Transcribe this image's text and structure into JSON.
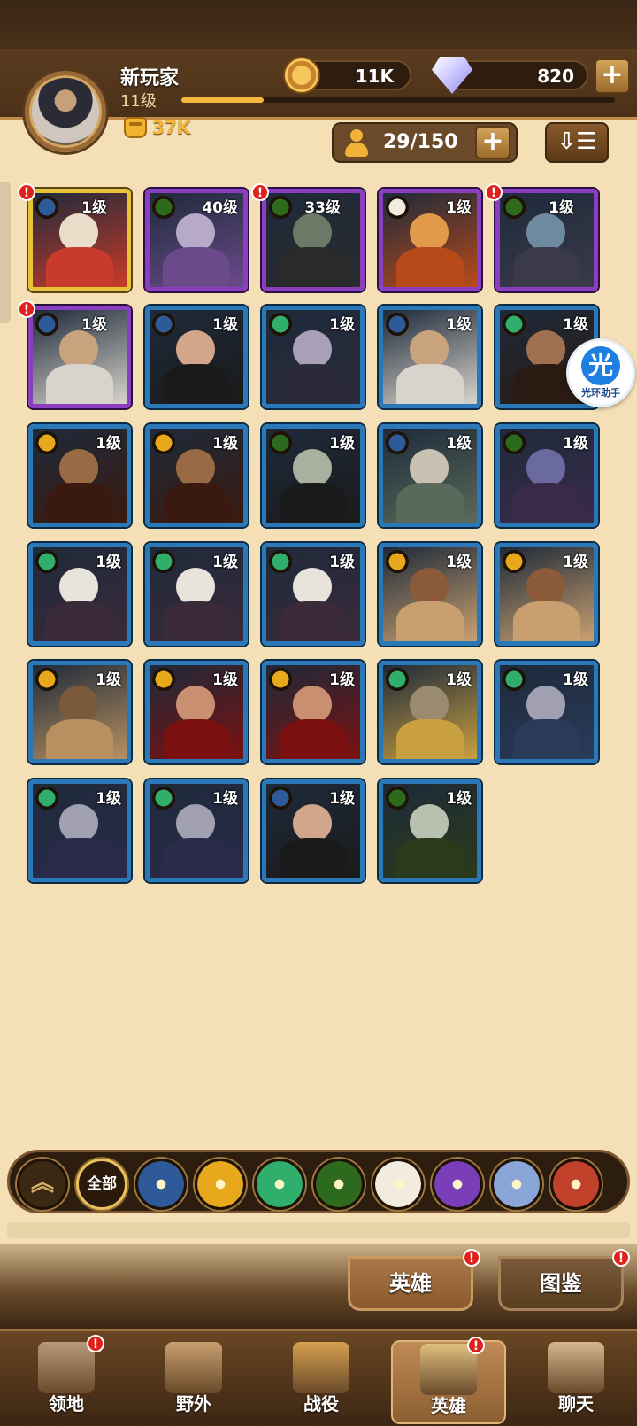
{
  "player": {
    "name": "新玩家",
    "level": "11级",
    "exp_fraction": 0.19,
    "power": "37K"
  },
  "resources": {
    "gold": "11K",
    "gems": "820"
  },
  "roster": {
    "count": "29/150"
  },
  "helper": {
    "glyph": "光",
    "label": "光环助手"
  },
  "heroes": [
    {
      "level": "1级",
      "rarity": "gold",
      "faction": "lightbearer",
      "alert": "!"
    },
    {
      "level": "40级",
      "rarity": "purple",
      "faction": "graveborn",
      "alert": ""
    },
    {
      "level": "33级",
      "rarity": "purple",
      "faction": "graveborn",
      "alert": "!"
    },
    {
      "level": "1级",
      "rarity": "purple",
      "faction": "celestial",
      "alert": ""
    },
    {
      "level": "1级",
      "rarity": "purple",
      "faction": "graveborn",
      "alert": "!"
    },
    {
      "level": "1级",
      "rarity": "purple",
      "faction": "lightbearer",
      "alert": "!"
    },
    {
      "level": "1级",
      "rarity": "blue",
      "faction": "lightbearer",
      "alert": ""
    },
    {
      "level": "1级",
      "rarity": "blue",
      "faction": "wilder",
      "alert": ""
    },
    {
      "level": "1级",
      "rarity": "blue",
      "faction": "lightbearer",
      "alert": ""
    },
    {
      "level": "1级",
      "rarity": "blue",
      "faction": "wilder",
      "alert": ""
    },
    {
      "level": "1级",
      "rarity": "blue",
      "faction": "mauler",
      "alert": ""
    },
    {
      "level": "1级",
      "rarity": "blue",
      "faction": "mauler",
      "alert": ""
    },
    {
      "level": "1级",
      "rarity": "blue",
      "faction": "graveborn",
      "alert": ""
    },
    {
      "level": "1级",
      "rarity": "blue",
      "faction": "lightbearer",
      "alert": ""
    },
    {
      "level": "1级",
      "rarity": "blue",
      "faction": "graveborn",
      "alert": ""
    },
    {
      "level": "1级",
      "rarity": "blue",
      "faction": "wilder",
      "alert": ""
    },
    {
      "level": "1级",
      "rarity": "blue",
      "faction": "wilder",
      "alert": ""
    },
    {
      "level": "1级",
      "rarity": "blue",
      "faction": "wilder",
      "alert": ""
    },
    {
      "level": "1级",
      "rarity": "blue",
      "faction": "mauler",
      "alert": ""
    },
    {
      "level": "1级",
      "rarity": "blue",
      "faction": "mauler",
      "alert": ""
    },
    {
      "level": "1级",
      "rarity": "blue",
      "faction": "mauler",
      "alert": ""
    },
    {
      "level": "1级",
      "rarity": "blue",
      "faction": "mauler",
      "alert": ""
    },
    {
      "level": "1级",
      "rarity": "blue",
      "faction": "mauler",
      "alert": ""
    },
    {
      "level": "1级",
      "rarity": "blue",
      "faction": "wilder",
      "alert": ""
    },
    {
      "level": "1级",
      "rarity": "blue",
      "faction": "wilder",
      "alert": ""
    },
    {
      "level": "1级",
      "rarity": "blue",
      "faction": "wilder",
      "alert": ""
    },
    {
      "level": "1级",
      "rarity": "blue",
      "faction": "wilder",
      "alert": ""
    },
    {
      "level": "1级",
      "rarity": "blue",
      "faction": "lightbearer",
      "alert": ""
    },
    {
      "level": "1级",
      "rarity": "blue",
      "faction": "graveborn",
      "alert": ""
    }
  ],
  "filters": [
    {
      "name": "collapse-filter-icon",
      "label": "︽"
    },
    {
      "name": "all",
      "label": "全部"
    },
    {
      "name": "lightbearer",
      "label": ""
    },
    {
      "name": "mauler",
      "label": ""
    },
    {
      "name": "wilder",
      "label": ""
    },
    {
      "name": "graveborn",
      "label": ""
    },
    {
      "name": "celestial",
      "label": ""
    },
    {
      "name": "hypogean",
      "label": ""
    },
    {
      "name": "dimensional",
      "label": ""
    },
    {
      "name": "faction-red",
      "label": ""
    }
  ],
  "subtabs": {
    "heroes": "英雄",
    "codex": "图鉴",
    "alert": "!"
  },
  "nav": [
    {
      "label": "领地",
      "alert": "!"
    },
    {
      "label": "野外",
      "alert": ""
    },
    {
      "label": "战役",
      "alert": ""
    },
    {
      "label": "英雄",
      "alert": "!"
    },
    {
      "label": "聊天",
      "alert": ""
    }
  ],
  "colors": {
    "lightbearer": "#2f5a9a",
    "mauler": "#e8a81c",
    "wilder": "#2fae6c",
    "graveborn": "#2e6a1e",
    "celestial": "#f2ecde",
    "hypogean": "#7a3fb8",
    "dimensional": "#8aa6d8",
    "faction-red": "#c2412a"
  }
}
